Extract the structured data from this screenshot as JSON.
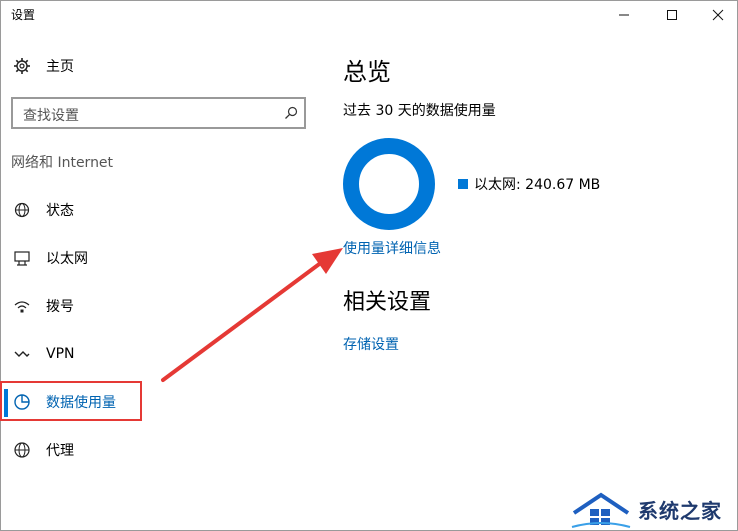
{
  "window": {
    "title": "设置",
    "controls": {
      "minimize": "—",
      "maximize": "☐",
      "close": "✕"
    }
  },
  "sidebar": {
    "home_label": "主页",
    "search_placeholder": "查找设置",
    "group_label": "网络和 Internet",
    "items": [
      {
        "label": "状态",
        "icon": "status-icon"
      },
      {
        "label": "以太网",
        "icon": "ethernet-icon"
      },
      {
        "label": "拨号",
        "icon": "dialup-icon"
      },
      {
        "label": "VPN",
        "icon": "vpn-icon"
      },
      {
        "label": "数据使用量",
        "icon": "data-usage-icon",
        "active": true
      },
      {
        "label": "代理",
        "icon": "proxy-icon"
      }
    ]
  },
  "main": {
    "overview_title": "总览",
    "period_text": "过去 30 天的数据使用量",
    "legend_label": "以太网: 240.67 MB",
    "usage_details_link": "使用量详细信息",
    "related_title": "相关设置",
    "storage_link": "存储设置"
  },
  "colors": {
    "accent": "#0078d7",
    "link": "#0063b1",
    "annotation": "#e53935"
  },
  "watermark": {
    "text": "系统之家"
  }
}
